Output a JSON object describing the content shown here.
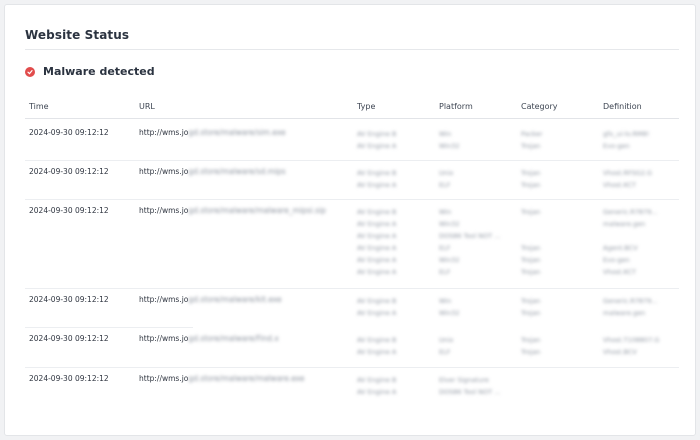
{
  "card": {
    "title": "Website Status"
  },
  "alert": {
    "text": "Malware detected",
    "color": "#e14c4c",
    "icon": "check-badge-icon"
  },
  "table": {
    "headers": {
      "time": "Time",
      "url": "URL",
      "type": "Type",
      "platform": "Platform",
      "category": "Category",
      "definition": "Definition"
    },
    "rows": [
      {
        "time": "2024-09-30 09:12:12",
        "url_visible": "http://wms.jo",
        "url_hidden": "gd.store/malware/sim.exe",
        "types": [
          "AV Engine B",
          "AV Engine A"
        ],
        "platforms": [
          "Win",
          "Win32"
        ],
        "categories": [
          "Packer",
          "Trojan"
        ],
        "definitions": [
          "gfx_ui-lo.RM8!",
          "Evo-gen"
        ]
      },
      {
        "time": "2024-09-30 09:12:12",
        "url_visible": "http://wms.jo",
        "url_hidden": "gd.store/malware/sd.mips",
        "types": [
          "AV Engine B",
          "AV Engine A"
        ],
        "platforms": [
          "Unix",
          "ELF"
        ],
        "categories": [
          "Trojan",
          "Trojan"
        ],
        "definitions": [
          "Vhost.RFSG2.G",
          "Vhost.KCT"
        ]
      },
      {
        "time": "2024-09-30 09:12:12",
        "url_visible": "http://wms.jo",
        "url_hidden": "gd.store/malware/malware_mipsi.sip",
        "types": [
          "AV Engine B",
          "AV Engine A",
          "AV Engine A",
          "AV Engine A",
          "AV Engine A",
          "AV Engine A"
        ],
        "platforms": [
          "Win",
          "Win32",
          "DOS86 Tool NOT ...",
          "ELF",
          "Win32",
          "ELF"
        ],
        "categories": [
          "Trojan",
          "",
          "",
          "Trojan",
          "Trojan",
          "Trojan"
        ],
        "definitions": [
          "Generic.R7879...",
          "malware.gen",
          "",
          "Agent.BCV",
          "Evo-gen",
          "Vhost.KCT"
        ]
      },
      {
        "time": "2024-09-30 09:12:12",
        "url_visible": "http://wms.jo",
        "url_hidden": "gd.store/malware/kit.exe",
        "types": [
          "AV Engine B",
          "AV Engine A"
        ],
        "platforms": [
          "Win",
          "Win32"
        ],
        "categories": [
          "Trojan",
          "Trojan"
        ],
        "definitions": [
          "Generic.R7879...",
          "malware.gen"
        ]
      },
      {
        "time": "2024-09-30 09:12:12",
        "url_visible": "http://wms.jo",
        "url_hidden": "gd.store/malware/Find.x",
        "types": [
          "AV Engine B",
          "AV Engine A"
        ],
        "platforms": [
          "Unix",
          "ELF"
        ],
        "categories": [
          "Trojan",
          "Trojan"
        ],
        "definitions": [
          "Vhost.T108807.G",
          "Vhost.BCV"
        ]
      },
      {
        "time": "2024-09-30 09:12:12",
        "url_visible": "http://wms.jo",
        "url_hidden": "gd.store/malware/malware.exe",
        "types": [
          "AV Engine B",
          "AV Engine A"
        ],
        "platforms": [
          "Elver Signature",
          "DOS86 Tool NOT ..."
        ],
        "categories": [
          "",
          ""
        ],
        "definitions": [
          "",
          ""
        ]
      }
    ]
  }
}
